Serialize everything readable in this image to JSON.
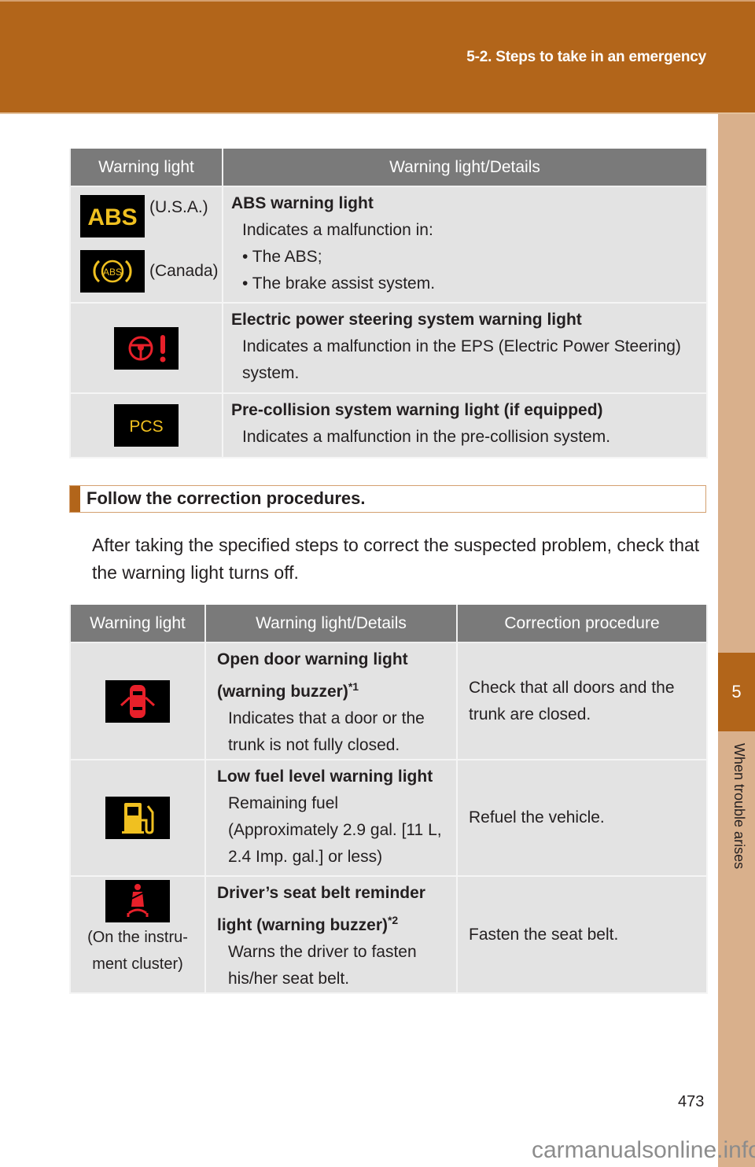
{
  "header": {
    "title": "5-2. Steps to take in an emergency"
  },
  "side_tab": {
    "chapter_number": "5",
    "chapter_label": "When trouble arises"
  },
  "table1": {
    "headers": [
      "Warning light",
      "Warning light/Details"
    ],
    "rows": [
      {
        "icons": [
          {
            "name": "abs-usa-icon",
            "glyph": "ABS",
            "color": "#f0c020",
            "caption": "(U.S.A.)"
          },
          {
            "name": "abs-canada-icon",
            "glyph": "(ABS)",
            "color": "#f0c020",
            "caption": "(Canada)"
          }
        ],
        "title": "ABS warning light",
        "lines": [
          "Indicates a malfunction in:",
          "• The ABS;",
          "• The brake assist system."
        ]
      },
      {
        "icons": [
          {
            "name": "power-steering-warning-icon",
            "color": "#e8202a"
          }
        ],
        "title": "Electric power steering system warning light",
        "lines": [
          "Indicates a malfunction in the EPS (Electric Power Steering) system."
        ]
      },
      {
        "icons": [
          {
            "name": "pcs-warning-icon",
            "glyph": "PCS",
            "color": "#f0c020"
          }
        ],
        "title": "Pre-collision system warning light (if equipped)",
        "lines": [
          "Indicates a malfunction in the pre-collision system."
        ]
      }
    ]
  },
  "section": {
    "heading": "Follow the correction procedures.",
    "intro": "After taking the specified steps to correct the suspected problem, check that the warning light turns off."
  },
  "table2": {
    "headers": [
      "Warning light",
      "Warning light/Details",
      "Correction procedure"
    ],
    "rows": [
      {
        "icon": {
          "name": "open-door-icon",
          "color": "#e8202a"
        },
        "caption": "",
        "title": "Open door warning light (warning buzzer)",
        "footnote": "*1",
        "lines": [
          "Indicates that a door or the trunk is not fully closed."
        ],
        "procedure": "Check that all doors and the trunk are closed."
      },
      {
        "icon": {
          "name": "low-fuel-icon",
          "color": "#f0c020"
        },
        "caption": "",
        "title": "Low fuel level warning light",
        "footnote": "",
        "lines": [
          "Remaining fuel (Approximately 2.9 gal. [11 L, 2.4 Imp. gal.] or less)"
        ],
        "procedure": "Refuel the vehicle."
      },
      {
        "icon": {
          "name": "seat-belt-reminder-icon",
          "color": "#e8202a"
        },
        "caption": "(On the instru-ment cluster)",
        "title": "Driver’s seat belt reminder light (warning buzzer)",
        "footnote": "*2",
        "lines": [
          "Warns the driver to fasten his/her seat belt."
        ],
        "procedure": "Fasten the seat belt."
      }
    ]
  },
  "footer": {
    "page_number": "473",
    "watermark": "carmanualsonline.info"
  }
}
